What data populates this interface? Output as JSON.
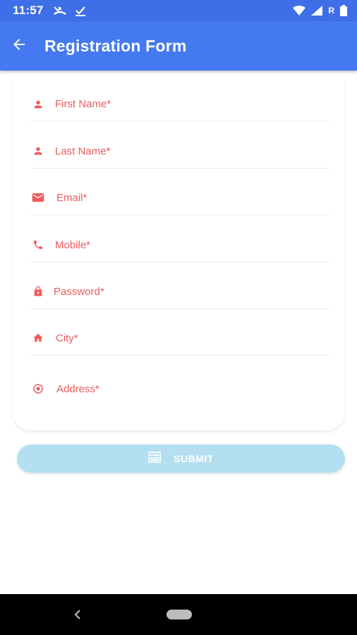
{
  "status_bar": {
    "time": "11:57",
    "network_label": "R",
    "icons": [
      "missed-call-icon",
      "checkbox-icon",
      "wifi-icon",
      "signal-icon",
      "battery-icon"
    ]
  },
  "app_bar": {
    "title": "Registration Form",
    "back_icon": "arrow-back-icon"
  },
  "form": {
    "fields": [
      {
        "label": "First Name*",
        "icon": "person-icon"
      },
      {
        "label": "Last Name*",
        "icon": "person-icon"
      },
      {
        "label": "Email*",
        "icon": "email-icon"
      },
      {
        "label": "Mobile*",
        "icon": "phone-icon"
      },
      {
        "label": "Password*",
        "icon": "lock-icon"
      },
      {
        "label": "City*",
        "icon": "home-icon"
      },
      {
        "label": "Address*",
        "icon": "location-icon"
      }
    ]
  },
  "submit": {
    "label": "SUBMIT",
    "icon": "form-icon"
  },
  "colors": {
    "appbar": "#4479f2",
    "statusbar": "#3f6fe8",
    "field_text": "#f05a5a",
    "submit_bg": "#b4dff0"
  }
}
